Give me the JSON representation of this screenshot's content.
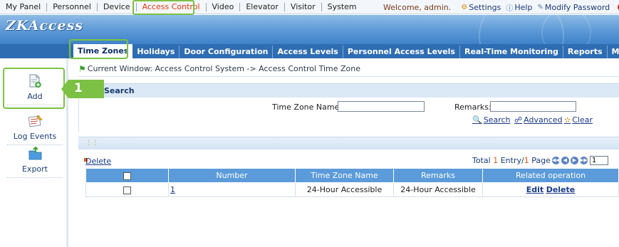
{
  "top_menu": {
    "items": [
      {
        "label": "My Panel"
      },
      {
        "label": "Personnel"
      },
      {
        "label": "Device"
      },
      {
        "label": "Access Control"
      },
      {
        "label": "Video"
      },
      {
        "label": "Elevator"
      },
      {
        "label": "Visitor"
      },
      {
        "label": "System"
      }
    ],
    "active_index": 3,
    "welcome": "Welcome, admin.",
    "settings": "Settings",
    "help": "Help",
    "modify_password": "Modify Password"
  },
  "banner": {
    "logo": "ZKAccess"
  },
  "tabs": [
    {
      "label": "Time Zones"
    },
    {
      "label": "Holidays"
    },
    {
      "label": "Door Configuration"
    },
    {
      "label": "Access Levels"
    },
    {
      "label": "Personnel Access Levels"
    },
    {
      "label": "Real-Time Monitoring"
    },
    {
      "label": "Reports"
    },
    {
      "label": "More..."
    }
  ],
  "sidebar": {
    "buttons": [
      {
        "label": "Add",
        "icon": "add-document-icon"
      },
      {
        "label": "Log Events",
        "icon": "log-events-icon"
      },
      {
        "label": "Export",
        "icon": "export-icon"
      }
    ]
  },
  "breadcrumb": "Current Window: Access Control System -> Access Control Time Zone",
  "callout_number": "1",
  "search": {
    "title": "Search",
    "name_label": "Time Zone Name:",
    "name_value": "",
    "remarks_label": "Remarks:",
    "remarks_value": "",
    "search_link": "Search",
    "advanced_link": "Advanced",
    "clear_link": "Clear"
  },
  "list": {
    "delete_link": "Delete",
    "paging": {
      "total_prefix": "Total",
      "total_count": "1",
      "entry_label": "Entry/",
      "page_count": "1",
      "page_label": "Page",
      "current_page": "1"
    },
    "columns": [
      "",
      "Number",
      "Time Zone Name",
      "Remarks",
      "Related operation"
    ],
    "rows": [
      {
        "number": "1",
        "time_zone_name": "24-Hour Accessible",
        "remarks": "24-Hour Accessible",
        "edit": "Edit",
        "delete": "Delete"
      }
    ]
  },
  "colors": {
    "highlight": "#7cc143",
    "tab_bar": "#2f6db3",
    "table_header": "#5b9bd9",
    "active_menu": "#e03a0d"
  }
}
